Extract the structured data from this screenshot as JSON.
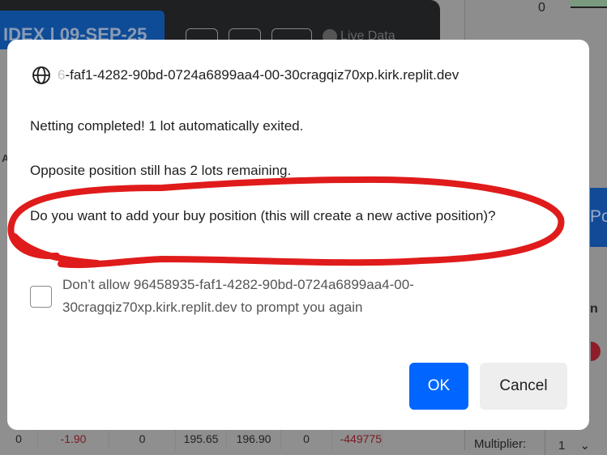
{
  "background": {
    "tab_label": "IDEX | 09-SEP-25",
    "live_label": "Live Data",
    "right_zero": "0",
    "right_button_partial": "Po",
    "right_header_partial": "n",
    "left_header_partial": "A",
    "multiplier_label": "Multiplier:",
    "multiplier_value": "1",
    "row": [
      "0",
      "-1.90",
      "0",
      "195.65",
      "196.90",
      "0",
      "-449775"
    ]
  },
  "dialog": {
    "origin_faded": "6",
    "origin": "-faf1-4282-90bd-0724a6899aa4-00-30cragqiz70xp.kirk.replit.dev",
    "line1": "Netting completed! 1 lot automatically exited.",
    "line2": "Opposite position still has 2 lots remaining.",
    "line3": "Do you want to add your buy position (this will create a new active position)?",
    "checkbox_label": "Don’t allow 96458935-faf1-4282-90bd-0724a6899aa4-00-30cragqiz70xp.kirk.replit.dev to prompt you again",
    "checkbox_checked": false,
    "ok_label": "OK",
    "cancel_label": "Cancel",
    "ok_color": "#0066ff",
    "annotation_color": "#e01b1b"
  }
}
